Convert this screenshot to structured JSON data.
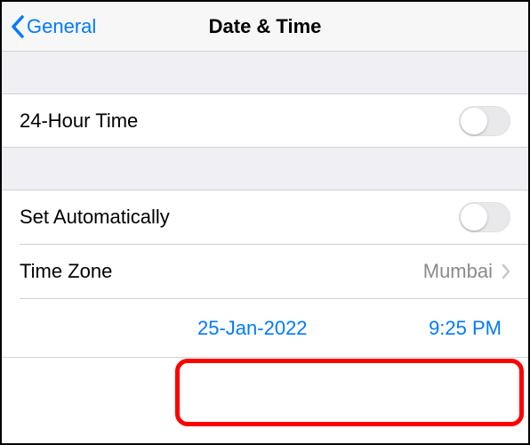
{
  "nav": {
    "back_label": "General",
    "title": "Date & Time"
  },
  "section1": {
    "twenty_four_hour_label": "24-Hour Time",
    "twenty_four_hour_on": false
  },
  "section2": {
    "set_automatically_label": "Set Automatically",
    "set_automatically_on": false,
    "time_zone_label": "Time Zone",
    "time_zone_value": "Mumbai",
    "date_value": "25-Jan-2022",
    "time_value": "9:25 PM"
  },
  "colors": {
    "accent": "#007aff",
    "highlight": "#ff0000"
  }
}
